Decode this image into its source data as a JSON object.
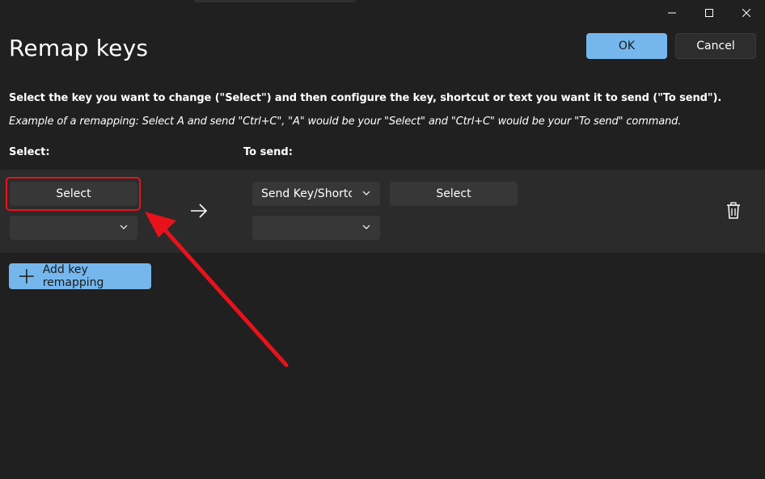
{
  "window": {
    "controls": {
      "minimize_icon": "minimize-icon",
      "maximize_icon": "maximize-icon",
      "close_icon": "close-icon"
    }
  },
  "header": {
    "title": "Remap keys",
    "ok_label": "OK",
    "cancel_label": "Cancel"
  },
  "instructions": {
    "main": "Select the key you want to change (\"Select\") and then configure the key, shortcut or text you want it to send (\"To send\").",
    "example": "Example of a remapping: Select A and send \"Ctrl+C\", \"A\" would be your \"Select\" and \"Ctrl+C\" would be your \"To send\" command."
  },
  "columns": {
    "select_label": "Select:",
    "to_send_label": "To send:"
  },
  "rows": [
    {
      "original": {
        "select_button_label": "Select",
        "dropdown_value": ""
      },
      "arrow_icon": "arrow-right-icon",
      "to_send": {
        "type_value": "Send Key/Shortcu",
        "select_button_label": "Select",
        "dropdown_value": ""
      },
      "delete_icon": "trash-icon"
    }
  ],
  "add_button": {
    "label": "Add key remapping",
    "icon": "plus-icon"
  },
  "colors": {
    "background": "#202020",
    "row_background": "#2b2b2b",
    "control": "#373737",
    "accent": "#75b7ec",
    "annotation": "#e8121b"
  }
}
